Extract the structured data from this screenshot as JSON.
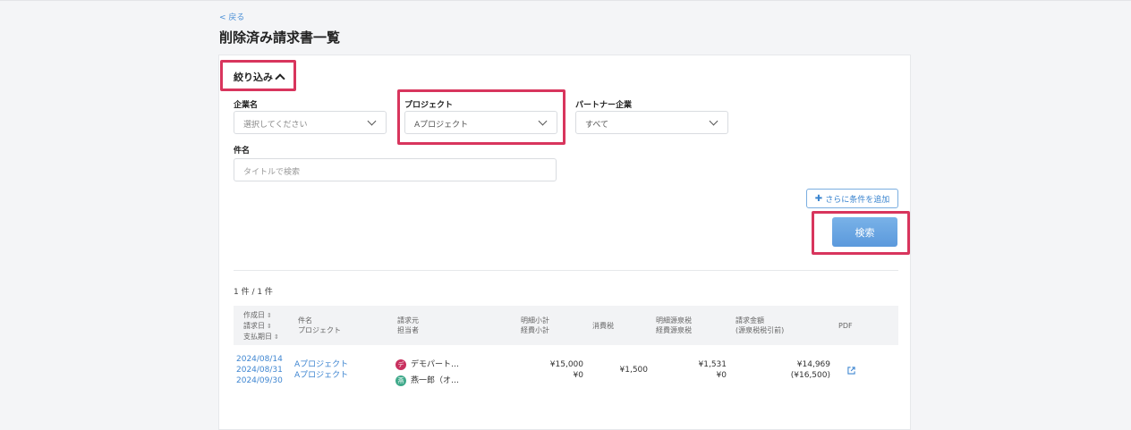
{
  "nav": {
    "back_label": "< 戻る"
  },
  "page": {
    "title": "削除済み請求書一覧"
  },
  "filter": {
    "toggle_label": "絞り込み",
    "company": {
      "label": "企業名",
      "value": "選択してください"
    },
    "project": {
      "label": "プロジェクト",
      "value": "Aプロジェクト"
    },
    "partner": {
      "label": "パートナー企業",
      "value": "すべて"
    },
    "subject": {
      "label": "件名",
      "placeholder": "タイトルで検索"
    },
    "add_condition_label": "さらに条件を追加",
    "search_label": "検索"
  },
  "results": {
    "count": "1 件 / 1 件"
  },
  "table": {
    "headers": {
      "dates": [
        "作成日",
        "請求日",
        "支払期日"
      ],
      "subject": [
        "件名",
        "プロジェクト"
      ],
      "client": [
        "請求元",
        "担当者"
      ],
      "subtotal": [
        "明細小計",
        "経費小計"
      ],
      "tax": "消費税",
      "withholding": [
        "明細源泉税",
        "経費源泉税"
      ],
      "amount": [
        "請求金額",
        "(源泉税税引前)"
      ],
      "pdf": "PDF"
    },
    "rows": [
      {
        "created": "2024/08/14",
        "billed": "2024/08/31",
        "due": "2024/09/30",
        "subject": "Aプロジェクト",
        "project": "Aプロジェクト",
        "partner_initial": "デ",
        "partner": "デモパート…",
        "person_initial": "燕",
        "person": "燕一郎（オ…",
        "subtotal": "¥15,000",
        "expense_subtotal": "¥0",
        "tax": "¥1,500",
        "withholding": "¥1,531",
        "expense_withholding": "¥0",
        "amount": "¥14,969",
        "amount_pre_tax": "(¥16,500)"
      }
    ]
  },
  "colors": {
    "highlight": "#d8355d",
    "accent": "#3f86d1",
    "partner_avatar": "#c8315f",
    "person_avatar": "#3fa98a"
  },
  "icons": {
    "external_link": "external-link-icon",
    "toggle": "chevron-up-icon",
    "add": "plus-icon",
    "select": "chevron-down-icon"
  }
}
